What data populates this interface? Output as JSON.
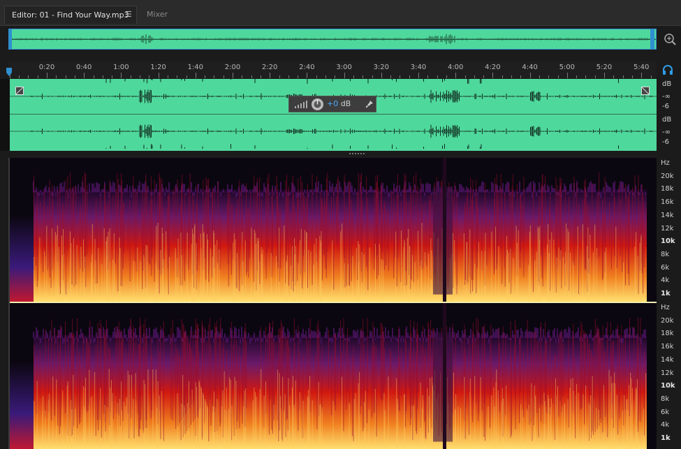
{
  "tabs": [
    {
      "label": "Editor: 01 - Find Your Way.mp3",
      "menu_icon": "menu-icon"
    },
    {
      "label": "Mixer"
    }
  ],
  "ruler": {
    "unit": "hms",
    "ticks": [
      "0:20",
      "0:40",
      "1:00",
      "1:20",
      "1:40",
      "2:00",
      "2:20",
      "2:40",
      "3:00",
      "3:20",
      "3:40",
      "4:00",
      "4:20",
      "4:40",
      "5:00",
      "5:20",
      "5:40"
    ]
  },
  "waveform": {
    "db_scale": [
      "dB",
      "-∞",
      "-6",
      "dB",
      "-∞",
      "-6"
    ],
    "hud": {
      "gain_prefix": "+0",
      "gain_unit": "dB"
    }
  },
  "spectrogram": {
    "freq_labels": [
      "Hz",
      "20k",
      "18k",
      "16k",
      "14k",
      "12k",
      "10k",
      "8k",
      "6k",
      "4k",
      "1k"
    ],
    "bold_labels": [
      "10k",
      "1k"
    ]
  },
  "colors": {
    "waveform": "#4fd89c",
    "selection": "#2f8fd0",
    "accent": "#48a8ff",
    "spectrum_low": "#1a0624",
    "spectrum_mid": "#d01810",
    "spectrum_high": "#ffe070"
  }
}
